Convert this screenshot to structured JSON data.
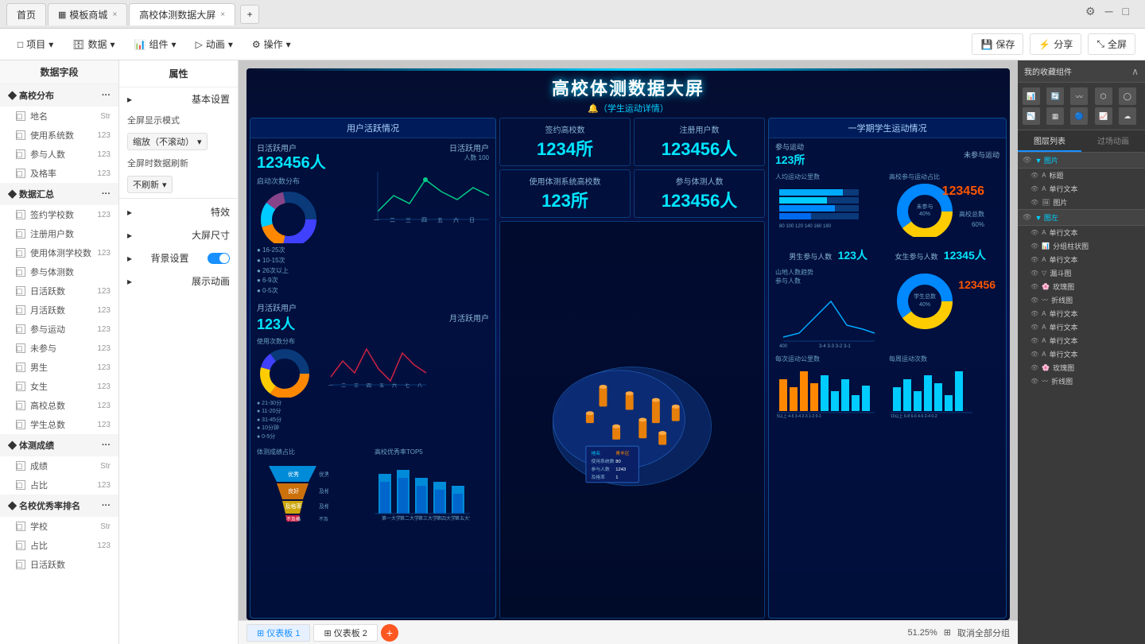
{
  "browser": {
    "tabs": [
      {
        "label": "首页",
        "active": false,
        "icon": ""
      },
      {
        "label": "模板商城",
        "active": false,
        "icon": "▦"
      },
      {
        "label": "高校体测数据大屏",
        "active": true,
        "icon": ""
      }
    ],
    "new_tab_label": "+",
    "window_controls": [
      "⚙",
      "□",
      "×"
    ]
  },
  "toolbar": {
    "items": [
      {
        "label": "项目",
        "icon": "□",
        "has_arrow": true
      },
      {
        "label": "数据",
        "icon": "🗄",
        "has_arrow": true
      },
      {
        "label": "组件",
        "icon": "📊",
        "has_arrow": true
      },
      {
        "label": "动画",
        "icon": "▷",
        "has_arrow": true
      },
      {
        "label": "操作",
        "icon": "⚙",
        "has_arrow": true
      }
    ],
    "right": [
      {
        "label": "保存",
        "icon": "💾"
      },
      {
        "label": "分享",
        "icon": "⚡"
      },
      {
        "label": "全屏",
        "icon": "⤡"
      }
    ]
  },
  "left_panel": {
    "title": "数据字段",
    "sections": [
      {
        "title": "高校分布",
        "items": [
          {
            "label": "地名",
            "value": "Str"
          },
          {
            "label": "使用系统数",
            "value": "123"
          },
          {
            "label": "参与人数",
            "value": "123"
          },
          {
            "label": "及格率",
            "value": "123"
          }
        ]
      },
      {
        "title": "数据汇总",
        "items": [
          {
            "label": "签约学校数",
            "value": "123"
          },
          {
            "label": "注册用户数",
            "value": ""
          },
          {
            "label": "使用体测学校数",
            "value": "123"
          },
          {
            "label": "参与体测数",
            "value": ""
          },
          {
            "label": "日活跃数",
            "value": "123"
          },
          {
            "label": "月活跃数",
            "value": "123"
          },
          {
            "label": "参与运动",
            "value": "123"
          },
          {
            "label": "未参与",
            "value": "123"
          },
          {
            "label": "男生",
            "value": "123"
          },
          {
            "label": "女生",
            "value": "123"
          },
          {
            "label": "高校总数",
            "value": "123"
          },
          {
            "label": "学生总数",
            "value": "123"
          }
        ]
      },
      {
        "title": "体测成绩",
        "items": [
          {
            "label": "成绩",
            "value": "Str"
          },
          {
            "label": "占比",
            "value": "123"
          }
        ]
      },
      {
        "title": "名校优秀率排名",
        "items": [
          {
            "label": "学校",
            "value": "Str"
          },
          {
            "label": "占比",
            "value": "123"
          },
          {
            "label": "日活跃数",
            "value": ""
          }
        ]
      }
    ]
  },
  "properties_panel": {
    "title": "属性",
    "sections": [
      {
        "label": "基本设置",
        "expanded": true
      },
      {
        "label": "全屏显示模式"
      },
      {
        "label": "缩放（不滚动）",
        "has_select": true,
        "select_value": "缩放（不滚动）"
      },
      {
        "label": "全屏时数据刷新"
      },
      {
        "label": "不刷新",
        "has_select": true,
        "select_value": "不刷新"
      },
      {
        "label": "特效",
        "expandable": true
      },
      {
        "label": "大屏尺寸",
        "expandable": true
      },
      {
        "label": "背景设置",
        "expandable": true,
        "has_toggle": true
      },
      {
        "label": "展示动画",
        "expandable": true
      }
    ]
  },
  "dashboard": {
    "title": "高校体测数据大屏",
    "subtitle": "🔔（学生运动详情）",
    "left_card": {
      "title": "用户活跃情况",
      "daily_label": "日活跃用户",
      "daily_value": "123456人",
      "monthly_label": "月活跃用户",
      "monthly_value": "123人"
    },
    "center_stats": [
      {
        "label": "签约高校数",
        "value": "1234所"
      },
      {
        "label": "注册用户数",
        "value": "123456人"
      },
      {
        "label": "使用体测系统高校数",
        "value": "123所"
      },
      {
        "label": "参与体测人数",
        "value": "123456人"
      }
    ],
    "right_card": {
      "title": "一学期学生运动情况",
      "participated_label": "参与运动",
      "participated_value": "123所",
      "not_participated_label": "未参与运动",
      "male_label": "男生参与人数",
      "male_value": "123人",
      "female_label": "女生参与人数",
      "female_value": "12345人"
    }
  },
  "right_panel": {
    "tabs": [
      "图层列表",
      "过场动画"
    ],
    "sections": [
      {
        "title": "▼ 图片",
        "items": [
          {
            "type": "标题",
            "label": "标题"
          },
          {
            "type": "单行文本",
            "label": "单行文本"
          },
          {
            "type": "图片",
            "label": "图片"
          }
        ]
      },
      {
        "title": "▼ 图左",
        "items": [
          {
            "type": "单行文本",
            "label": "单行文本"
          },
          {
            "type": "分组柱状图",
            "label": "分组柱状图"
          },
          {
            "type": "单行文本",
            "label": "单行文本"
          },
          {
            "type": "漏斗图",
            "label": "漏斗图"
          },
          {
            "type": "玫瑰图",
            "label": "玫瑰图"
          },
          {
            "type": "折线图",
            "label": "折线图"
          },
          {
            "type": "单行文本",
            "label": "单行文本"
          },
          {
            "type": "单行文本",
            "label": "单行文本"
          },
          {
            "type": "单行文本",
            "label": "单行文本"
          },
          {
            "type": "单行文本",
            "label": "单行文本"
          },
          {
            "type": "玫瑰图",
            "label": "玫瑰图"
          },
          {
            "type": "折线图",
            "label": "折线图"
          }
        ]
      }
    ]
  },
  "favorites": {
    "title": "我的收藏组件",
    "icons": [
      "📊",
      "🔄",
      "〰",
      "⬡",
      "◯",
      "📉",
      "▦",
      "🔵",
      "📈",
      "☁"
    ]
  },
  "bottom": {
    "tabs": [
      "仪表板 1",
      "仪表板 2"
    ],
    "add_label": "+",
    "zoom": "51.25%",
    "cancel_label": "取消全部分组"
  }
}
